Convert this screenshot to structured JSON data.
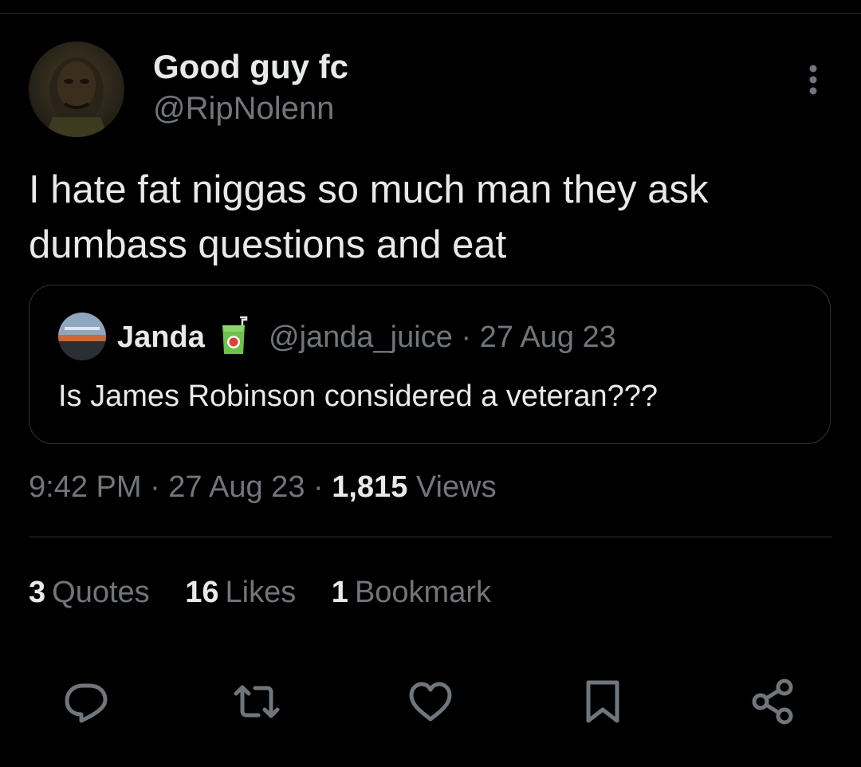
{
  "author": {
    "display_name": "Good guy fc",
    "handle": "@RipNolenn"
  },
  "tweet": {
    "text": "I hate fat niggas so much man they ask dumbass questions and eat"
  },
  "quoted": {
    "name": "Janda",
    "name_emoji_icon": "juice-box-icon",
    "meta": "@janda_juice · 27 Aug 23",
    "text": "Is James Robinson considered a veteran???"
  },
  "info": {
    "time_date": "9:42 PM · 27 Aug 23 · ",
    "views_count": "1,815",
    "views_label": " Views"
  },
  "stats": {
    "quotes_count": "3",
    "quotes_label": "Quotes",
    "likes_count": "16",
    "likes_label": "Likes",
    "bookmarks_count": "1",
    "bookmarks_label": "Bookmark"
  },
  "actions": [
    "reply-icon",
    "retweet-icon",
    "like-icon",
    "bookmark-icon",
    "share-icon"
  ],
  "colors": {
    "background": "#000000",
    "primary_text": "#e7e9ea",
    "secondary_text": "#71767b",
    "border": "#2f3336"
  }
}
